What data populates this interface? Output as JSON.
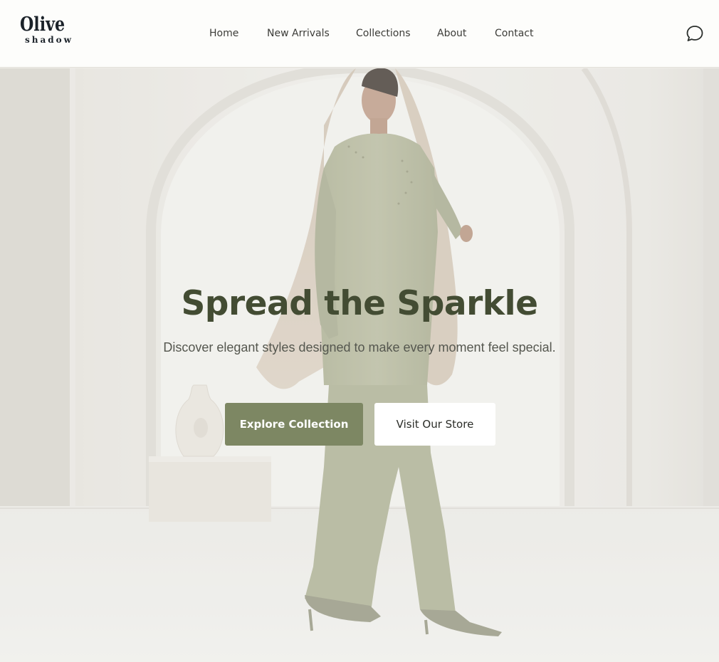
{
  "header": {
    "logo": {
      "line1": "Olive",
      "line2": "shadow"
    },
    "nav": [
      {
        "label": "Home"
      },
      {
        "label": "New Arrivals"
      },
      {
        "label": "Collections"
      },
      {
        "label": "About"
      },
      {
        "label": "Contact"
      }
    ],
    "chat_icon": "chat-bubble-icon"
  },
  "hero": {
    "title": "Spread the Sparkle",
    "subtitle": "Discover elegant styles designed to make every moment feel special.",
    "primary_button": "Explore Collection",
    "secondary_button": "Visit Our Store",
    "image": "model in olive green tunic and beige scarf standing in front of white arch"
  },
  "colors": {
    "accent": "#7d8763",
    "title": "#434c33",
    "header_bg": "#fdfdfb"
  }
}
